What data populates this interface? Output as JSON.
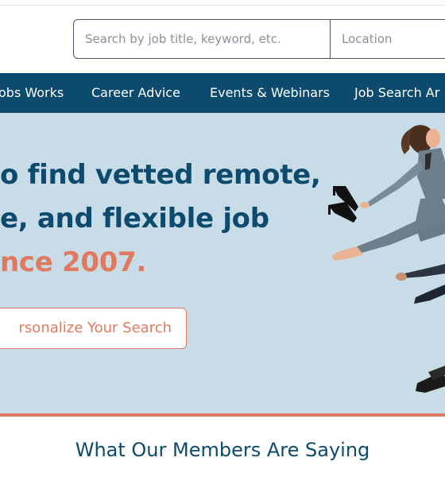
{
  "search": {
    "keyword_placeholder": "Search by job title, keyword, etc.",
    "location_placeholder": "Location"
  },
  "nav": {
    "items": [
      {
        "label": "obs Works"
      },
      {
        "label": "Career Advice"
      },
      {
        "label": "Events & Webinars"
      },
      {
        "label": "Job Search Ar"
      }
    ]
  },
  "hero": {
    "line1": "o find vetted remote,",
    "line2": "e, and flexible job",
    "line3": "nce 2007.",
    "cta_label": "rsonalize Your Search"
  },
  "members": {
    "title": "What Our Members Are Saying"
  },
  "colors": {
    "nav_background": "#0c4a6e",
    "hero_background": "#c8dce8",
    "accent": "#e07a5f",
    "heading": "#0c4a6e"
  }
}
